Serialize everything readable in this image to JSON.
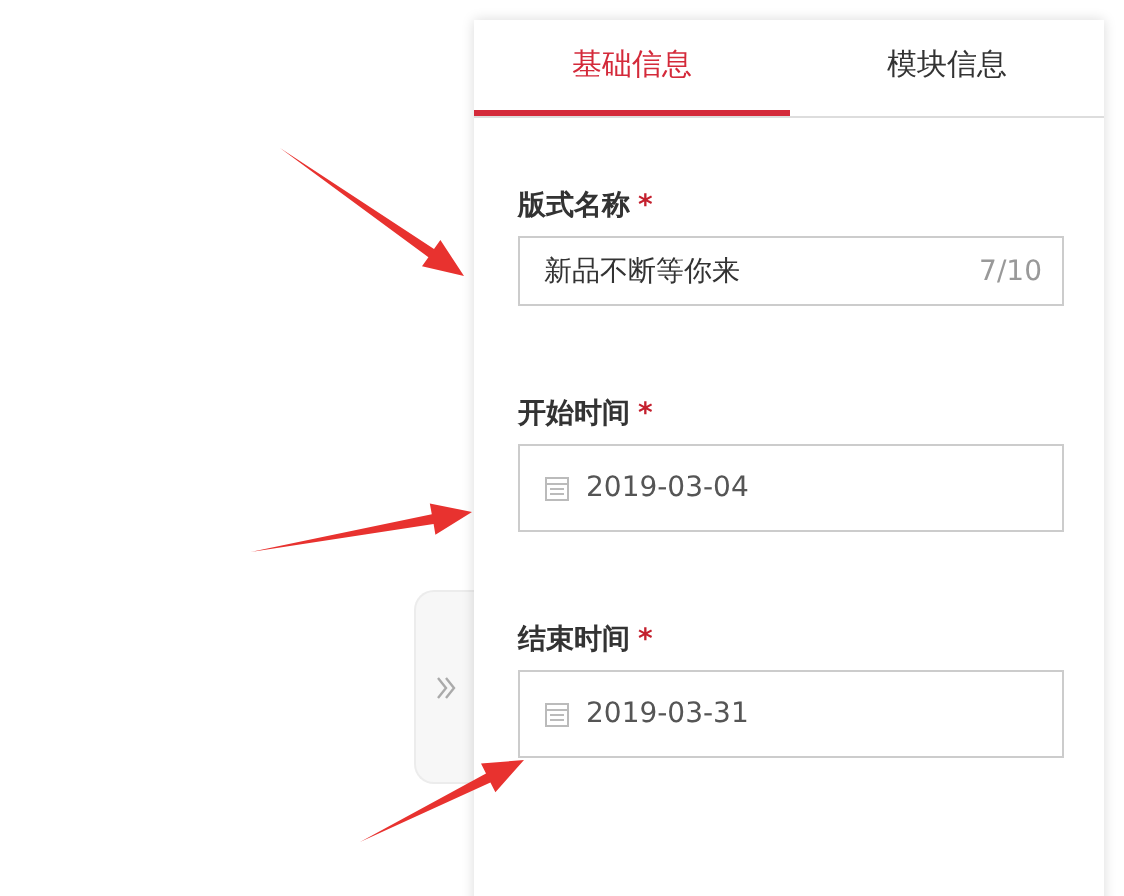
{
  "tabs": [
    {
      "label": "基础信息",
      "selected": true
    },
    {
      "label": "模块信息",
      "selected": false
    }
  ],
  "fields": [
    {
      "kind": "text",
      "label": "版式名称",
      "required_mark": "*",
      "value": "新品不断等你来",
      "counter": "7/10"
    },
    {
      "kind": "date",
      "label": "开始时间",
      "required_mark": "*",
      "value": "2019-03-04"
    },
    {
      "kind": "date",
      "label": "结束时间",
      "required_mark": "*",
      "value": "2019-03-31"
    }
  ]
}
